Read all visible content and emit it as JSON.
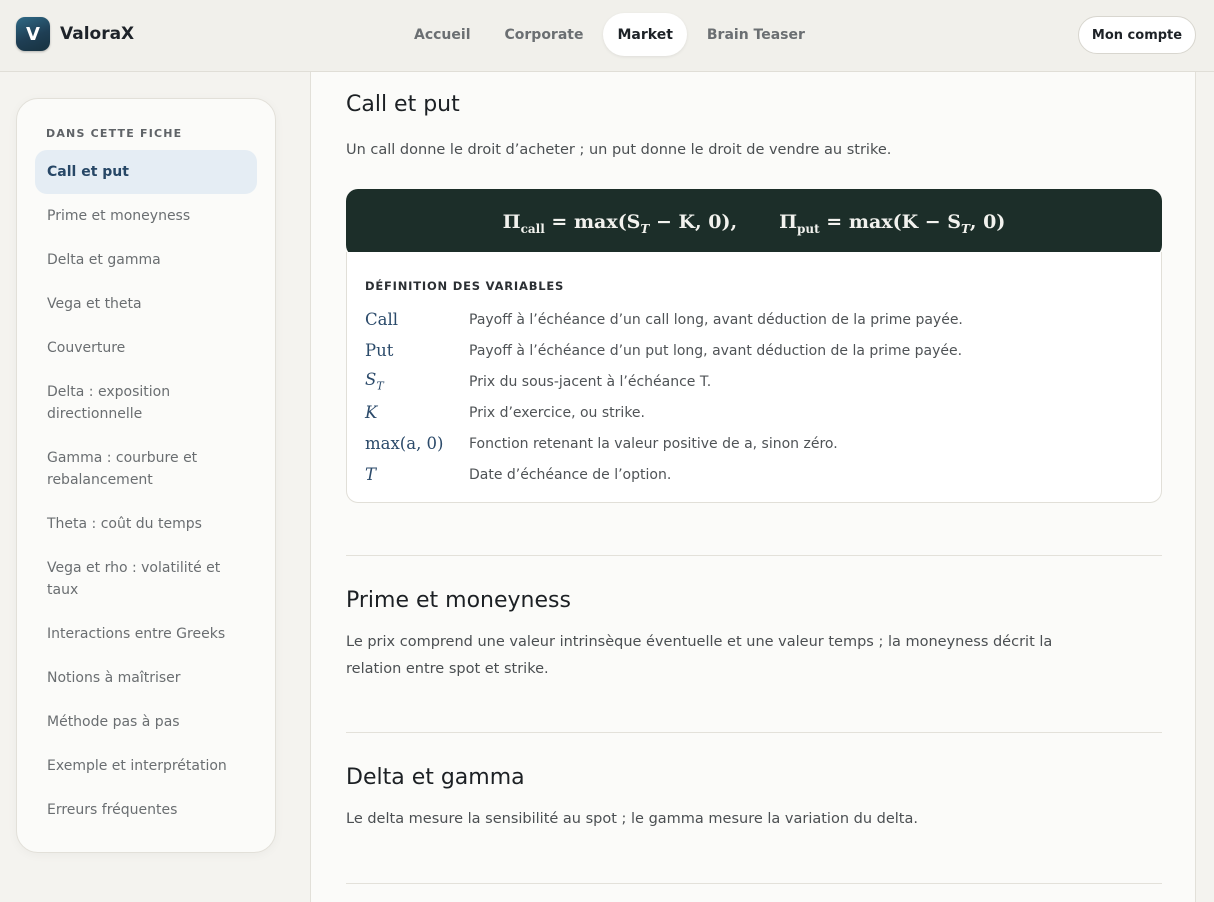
{
  "brand": {
    "logo_letter": "V",
    "name": "ValoraX"
  },
  "nav": {
    "tabs": [
      {
        "label": "Accueil",
        "active": false
      },
      {
        "label": "Corporate",
        "active": false
      },
      {
        "label": "Market",
        "active": true
      },
      {
        "label": "Brain Teaser",
        "active": false
      }
    ],
    "account_label": "Mon compte"
  },
  "sidebar": {
    "heading": "DANS CETTE FICHE",
    "items": [
      {
        "label": "Call et put",
        "active": true
      },
      {
        "label": "Prime et moneyness",
        "active": false
      },
      {
        "label": "Delta et gamma",
        "active": false
      },
      {
        "label": "Vega et theta",
        "active": false
      },
      {
        "label": "Couverture",
        "active": false
      },
      {
        "label": "Delta : exposition directionnelle",
        "active": false
      },
      {
        "label": "Gamma : courbure et rebalancement",
        "active": false
      },
      {
        "label": "Theta : coût du temps",
        "active": false
      },
      {
        "label": "Vega et rho : volatilité et taux",
        "active": false
      },
      {
        "label": "Interactions entre Greeks",
        "active": false
      },
      {
        "label": "Notions à maîtriser",
        "active": false
      },
      {
        "label": "Méthode pas à pas",
        "active": false
      },
      {
        "label": "Exemple et interprétation",
        "active": false
      },
      {
        "label": "Erreurs fréquentes",
        "active": false
      }
    ]
  },
  "sections": {
    "call_put": {
      "title": "Call et put",
      "text": "Un call donne le droit d’acheter ; un put donne le droit de vendre au strike.",
      "formula": {
        "call_lhs": "Π",
        "call_sub": "call",
        "call_rhs": " = max(S",
        "call_rhs_sub": "T",
        "call_rhs_end": " − K, 0),",
        "put_lhs": "Π",
        "put_sub": "put",
        "put_rhs": " = max(K − S",
        "put_rhs_sub": "T",
        "put_rhs_end": ", 0)"
      },
      "variables_heading": "DÉFINITION DES VARIABLES",
      "variables": [
        {
          "symbol": "Call",
          "sub": "",
          "description": "Payoff à l’échéance d’un call long, avant déduction de la prime payée."
        },
        {
          "symbol": "Put",
          "sub": "",
          "description": "Payoff à l’échéance d’un put long, avant déduction de la prime payée."
        },
        {
          "symbol": "S",
          "sub": "T",
          "description": "Prix du sous-jacent à l’échéance T."
        },
        {
          "symbol": "K",
          "sub": "",
          "description": "Prix d’exercice, ou strike."
        },
        {
          "symbol": "max(a, 0)",
          "sub": "",
          "description": "Fonction retenant la valeur positive de a, sinon zéro."
        },
        {
          "symbol": "T",
          "sub": "",
          "description": "Date d’échéance de l’option."
        }
      ]
    },
    "prime": {
      "title": "Prime et moneyness",
      "text": "Le prix comprend une valeur intrinsèque éventuelle et une valeur temps ; la moneyness décrit la relation entre spot et strike."
    },
    "delta": {
      "title": "Delta et gamma",
      "text": "Le delta mesure la sensibilité au spot ; le gamma mesure la variation du delta."
    }
  }
}
